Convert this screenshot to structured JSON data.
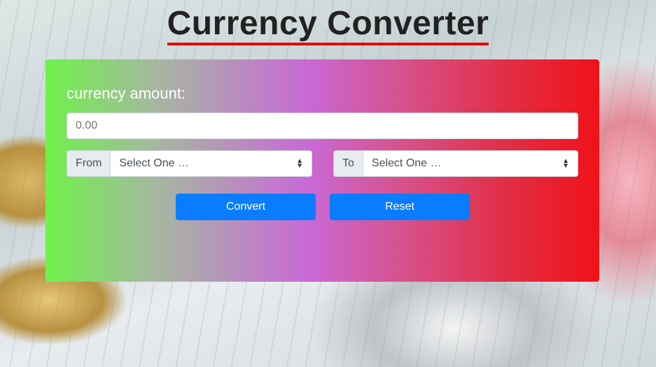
{
  "page": {
    "title": "Currency Converter"
  },
  "form": {
    "amount_label": "currency amount:",
    "amount_placeholder": "0.00",
    "from": {
      "addon_label": "From",
      "selected": "Select One …"
    },
    "to": {
      "addon_label": "To",
      "selected": "Select One …"
    },
    "buttons": {
      "convert_label": "Convert",
      "reset_label": "Reset"
    }
  },
  "icons": {
    "select_arrows": "up-down-caret-icon"
  },
  "colors": {
    "title_underline": "#e60000",
    "button_primary": "#0a7cff",
    "gradient_start": "#6ff24a",
    "gradient_mid": "#c86ad6",
    "gradient_end": "#f01218"
  }
}
